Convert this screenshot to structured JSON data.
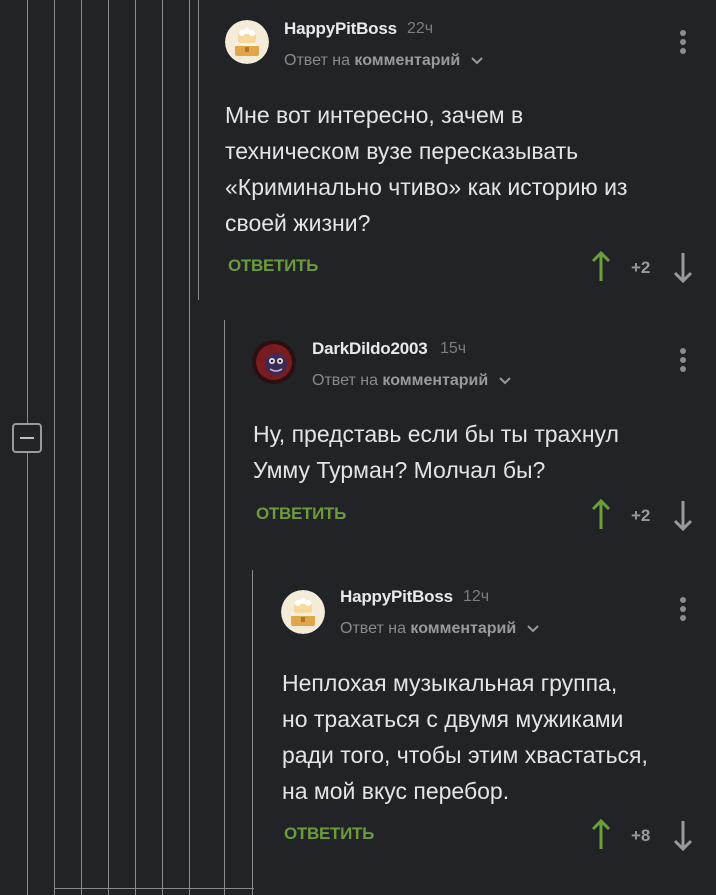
{
  "comments": [
    {
      "username": "HappyPitBoss",
      "time": "22ч",
      "reply_prefix": "Ответ на",
      "reply_target": "комментарий",
      "lines": [
        "Мне вот интересно, зачем в",
        "техническом вузе пересказывать",
        "«Криминально чтиво» как историю из",
        "своей жизни?"
      ],
      "reply_label": "ОТВЕТИТЬ",
      "score": "+2",
      "avatar": "cake-avatar"
    },
    {
      "username": "DarkDildo2003",
      "time": "15ч",
      "reply_prefix": "Ответ на",
      "reply_target": "комментарий",
      "lines": [
        "Ну, представь если бы ты трахнул",
        "Умму Турман? Молчал бы?"
      ],
      "reply_label": "ОТВЕТИТЬ",
      "score": "+2",
      "avatar": "dark-avatar"
    },
    {
      "username": "HappyPitBoss",
      "time": "12ч",
      "reply_prefix": "Ответ на",
      "reply_target": "комментарий",
      "lines": [
        "Неплохая музыкальная группа,",
        "но трахаться с двумя мужиками",
        "ради того, чтобы этим хвастаться,",
        "на мой вкус перебор."
      ],
      "reply_label": "ОТВЕТИТЬ",
      "score": "+8",
      "avatar": "cake-avatar"
    }
  ],
  "colors": {
    "background": "#222326",
    "accent_green": "#6a9b3c",
    "upvote_green": "#6aa03b",
    "thread_line": "#8a8a8a"
  }
}
